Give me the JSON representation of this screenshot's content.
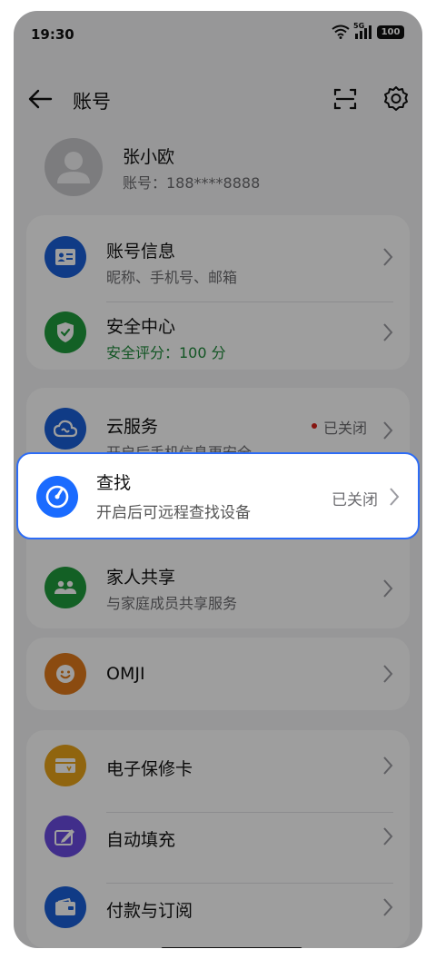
{
  "status": {
    "time": "19:30",
    "signal_label": "5G",
    "battery": "100"
  },
  "header": {
    "title": "账号"
  },
  "profile": {
    "name": "张小欧",
    "account": "账号：188****8888"
  },
  "group1": [
    {
      "title": "账号信息",
      "subtitle": "昵称、手机号、邮箱",
      "icon": "contact-card-icon",
      "color": "#1a5fd8"
    },
    {
      "title": "安全中心",
      "subtitle": "安全评分：100 分",
      "icon": "shield-check-icon",
      "color": "#1f9b3c"
    }
  ],
  "group2": [
    {
      "title": "云服务",
      "subtitle": "开启后手机信息更安全",
      "status": "已关闭",
      "icon": "cloud-icon",
      "color": "#1a5fd8"
    },
    {
      "title": "家人共享",
      "subtitle": "与家庭成员共享服务",
      "icon": "family-icon",
      "color": "#1f9b3c"
    }
  ],
  "find": {
    "title": "查找",
    "subtitle": "开启后可远程查找设备",
    "status": "已关闭",
    "icon": "radar-icon",
    "color": "#1a6bff"
  },
  "group3": [
    {
      "title": "OMJI",
      "icon": "smile-icon",
      "color": "#e07a1a"
    }
  ],
  "group4": [
    {
      "title": "电子保修卡",
      "icon": "warranty-card-icon",
      "color": "#e8a419"
    },
    {
      "title": "自动填充",
      "icon": "autofill-icon",
      "color": "#6a4be0"
    },
    {
      "title": "付款与订阅",
      "icon": "wallet-icon",
      "color": "#1a5fd8"
    }
  ]
}
